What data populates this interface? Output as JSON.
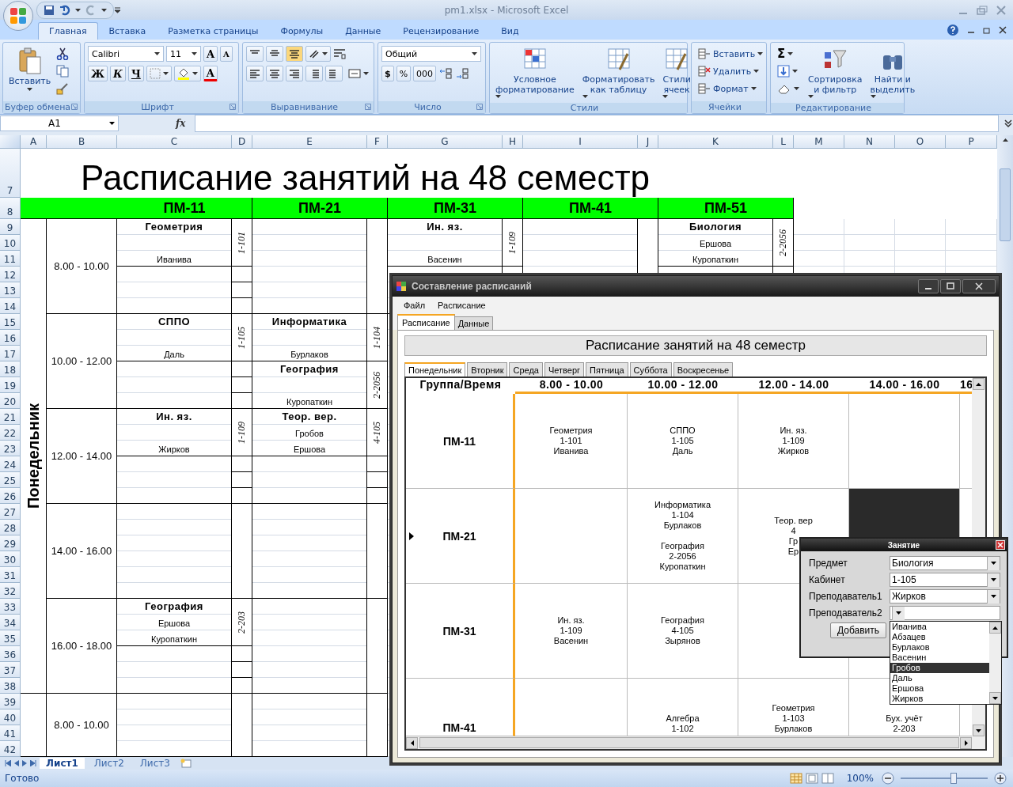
{
  "window": {
    "title": "pm1.xlsx - Microsoft Excel"
  },
  "ribbon_tabs": [
    {
      "label": "Главная",
      "selected": true
    },
    {
      "label": "Вставка",
      "selected": false
    },
    {
      "label": "Разметка страницы",
      "selected": false
    },
    {
      "label": "Формулы",
      "selected": false
    },
    {
      "label": "Данные",
      "selected": false
    },
    {
      "label": "Рецензирование",
      "selected": false
    },
    {
      "label": "Вид",
      "selected": false
    }
  ],
  "ribbon": {
    "clipboard": {
      "title": "Буфер обмена",
      "paste": "Вставить"
    },
    "font": {
      "title": "Шрифт",
      "family": "Calibri",
      "size": "11",
      "grow": "A",
      "shrink": "A",
      "bold": "Ж",
      "italic": "К",
      "underline": "Ч",
      "text_color_letter": "A"
    },
    "alignment": {
      "title": "Выравнивание"
    },
    "number": {
      "title": "Число",
      "format": "Общий",
      "currency": "$",
      "percent": "%",
      "thousands": "000"
    },
    "styles": {
      "title": "Стили",
      "buttons": [
        {
          "label": [
            "Условное",
            "форматирование"
          ]
        },
        {
          "label": [
            "Форматировать",
            "как таблицу"
          ]
        },
        {
          "label": [
            "Стили",
            "ячеек"
          ]
        }
      ]
    },
    "cells": {
      "title": "Ячейки",
      "buttons": [
        "Вставить",
        "Удалить",
        "Формат"
      ]
    },
    "editing": {
      "title": "Редактирование",
      "sum": "Σ",
      "buttons": [
        {
          "label": [
            "Сортировка",
            "и фильтр"
          ]
        },
        {
          "label": [
            "Найти и",
            "выделить"
          ]
        }
      ]
    }
  },
  "formula_bar": {
    "name_box": "A1",
    "fx": "fx"
  },
  "sheet": {
    "columns": [
      "A",
      "B",
      "C",
      "D",
      "E",
      "F",
      "G",
      "H",
      "I",
      "J",
      "K",
      "L",
      "M",
      "N",
      "O",
      "P"
    ],
    "rows": [
      "7",
      "8",
      "9",
      "10",
      "11",
      "12",
      "13",
      "14",
      "15",
      "16",
      "17",
      "18",
      "19",
      "20",
      "21",
      "22",
      "23",
      "24",
      "25",
      "26",
      "27",
      "28",
      "29",
      "30",
      "31",
      "32",
      "33",
      "34",
      "35",
      "36",
      "37",
      "38",
      "39",
      "40",
      "41",
      "42"
    ],
    "title": "Расписание занятий на 48 семестр",
    "groups": [
      "ПМ-11",
      "ПМ-21",
      "ПМ-31",
      "ПМ-41",
      "ПМ-51"
    ],
    "days": [
      {
        "name": "Понедельник",
        "slots": [
          {
            "time": "8.00 - 10.00",
            "cells": [
              {
                "lessons": [
                  {
                    "subject": "Геометрия",
                    "room": "1-101",
                    "teachers": [
                      "Иванива"
                    ]
                  }
                ]
              },
              {},
              {
                "lessons": [
                  {
                    "subject": "Ин. яз.",
                    "room": "1-109",
                    "teachers": [
                      "Васенин"
                    ]
                  }
                ]
              },
              {},
              {
                "lessons": [
                  {
                    "subject": "Биология",
                    "room": "2-2056",
                    "teachers": [
                      "Ершова",
                      "Куропаткин"
                    ]
                  }
                ]
              }
            ]
          },
          {
            "time": "10.00 - 12.00",
            "cells": [
              {
                "lessons": [
                  {
                    "subject": "СППО",
                    "room": "1-105",
                    "teachers": [
                      "Даль"
                    ]
                  }
                ]
              },
              {
                "lessons": [
                  {
                    "subject": "Информатика",
                    "room": "1-104",
                    "teachers": [
                      "Бурлаков"
                    ]
                  },
                  {
                    "subject": "География",
                    "room": "2-2056",
                    "teachers": [
                      "Куропаткин"
                    ]
                  }
                ]
              }
            ]
          },
          {
            "time": "12.00 - 14.00",
            "cells": [
              {
                "lessons": [
                  {
                    "subject": "Ин. яз.",
                    "room": "1-109",
                    "teachers": [
                      "Жирков"
                    ]
                  }
                ]
              },
              {
                "lessons": [
                  {
                    "subject": "Теор. вер.",
                    "room": "4-105",
                    "teachers": [
                      "Гробов",
                      "Ершова"
                    ]
                  }
                ]
              }
            ]
          },
          {
            "time": "14.00 - 16.00",
            "cells": [
              {},
              {}
            ]
          },
          {
            "time": "16.00 - 18.00",
            "cells": [
              {
                "lessons": [
                  {
                    "subject": "География",
                    "room": "2-203",
                    "teachers": [
                      "Ершова",
                      "Куропаткин"
                    ]
                  }
                ]
              },
              {}
            ]
          }
        ]
      },
      {
        "slots": [
          {
            "time": "8.00 - 10.00",
            "cells": [
              {},
              {}
            ]
          }
        ]
      }
    ]
  },
  "sheet_tabs": [
    {
      "label": "Лист1",
      "selected": true
    },
    {
      "label": "Лист2",
      "selected": false
    },
    {
      "label": "Лист3",
      "selected": false
    }
  ],
  "status_bar": {
    "status": "Готово",
    "zoom": "100%",
    "zoom_slider": {
      "level": 0.6
    }
  },
  "app": {
    "title": "Составление расписаний",
    "menu": [
      "Файл",
      "Расписание"
    ],
    "tabs": [
      {
        "label": "Расписание",
        "selected": true
      },
      {
        "label": "Данные",
        "selected": false
      }
    ],
    "heading": "Расписание занятий на 48 семестр",
    "day_tabs": [
      {
        "label": "Понедельник",
        "selected": true
      },
      {
        "label": "Вторник",
        "selected": false
      },
      {
        "label": "Среда",
        "selected": false
      },
      {
        "label": "Четверг",
        "selected": false
      },
      {
        "label": "Пятница",
        "selected": false
      },
      {
        "label": "Суббота",
        "selected": false
      },
      {
        "label": "Воскресенье",
        "selected": false
      }
    ],
    "grid": {
      "columns": [
        "Группа/Время",
        "8.00 - 10.00",
        "10.00 - 12.00",
        "12.00 - 14.00",
        "14.00 - 16.00",
        "16"
      ],
      "rows": [
        {
          "current": false,
          "cells": [
            {
              "text": "ПМ-11",
              "selected": false
            },
            {
              "lessons": [
                [
                  "Геометрия",
                  "1-101",
                  "Иванива"
                ]
              ],
              "selected": false
            },
            {
              "lessons": [
                [
                  "СППО",
                  "1-105",
                  "Даль"
                ]
              ],
              "selected": false
            },
            {
              "lessons": [
                [
                  "Ин. яз.",
                  "1-109",
                  "Жирков"
                ]
              ],
              "selected": false
            },
            {
              "selected": false
            }
          ]
        },
        {
          "current": true,
          "cells": [
            {
              "text": "ПМ-21",
              "selected": false
            },
            {
              "selected": false
            },
            {
              "lessons": [
                [
                  "Информатика",
                  "1-104",
                  "Бурлаков"
                ],
                [
                  "География",
                  "2-2056",
                  "Куропаткин"
                ]
              ],
              "selected": false
            },
            {
              "lessons": [
                [
                  "Теор. вер",
                  "4",
                  "Гр",
                  "Ер"
                ]
              ],
              "selected": false
            },
            {
              "selected": true
            }
          ]
        },
        {
          "current": false,
          "cells": [
            {
              "text": "ПМ-31",
              "selected": false
            },
            {
              "lessons": [
                [
                  "Ин. яз.",
                  "1-109",
                  "Васенин"
                ]
              ],
              "selected": false
            },
            {
              "lessons": [
                [
                  "География",
                  "4-105",
                  "Зырянов"
                ]
              ],
              "selected": false
            },
            {
              "selected": false
            },
            {
              "selected": false
            }
          ]
        },
        {
          "current": false,
          "cells": [
            {
              "text": "ПМ-41",
              "selected": false
            },
            {
              "selected": false
            },
            {
              "lessons": [
                [
                  "Алгебра",
                  "1-102"
                ]
              ],
              "selected": false
            },
            {
              "lessons": [
                [
                  "Геометрия",
                  "1-103",
                  "Бурлаков"
                ]
              ],
              "selected": false
            },
            {
              "lessons": [
                [
                  "Бух. учёт",
                  "2-203"
                ]
              ],
              "selected": false
            }
          ]
        }
      ]
    }
  },
  "dialog": {
    "title": "Занятие",
    "fields": [
      {
        "label": "Предмет",
        "value": "Биология"
      },
      {
        "label": "Кабинет",
        "value": "1-105"
      },
      {
        "label": "Преподаватель1",
        "value": "Жирков"
      },
      {
        "label": "Преподаватель2",
        "options": [
          {
            "label": "Иванива",
            "selected": false
          },
          {
            "label": "Абзацев",
            "selected": false
          },
          {
            "label": "Бурлаков",
            "selected": false
          },
          {
            "label": "Васенин",
            "selected": false
          },
          {
            "label": "Гробов",
            "selected": true
          },
          {
            "label": "Даль",
            "selected": false
          },
          {
            "label": "Ершова",
            "selected": false
          },
          {
            "label": "Жирков",
            "selected": false
          }
        ]
      }
    ],
    "button": "Добавить"
  }
}
